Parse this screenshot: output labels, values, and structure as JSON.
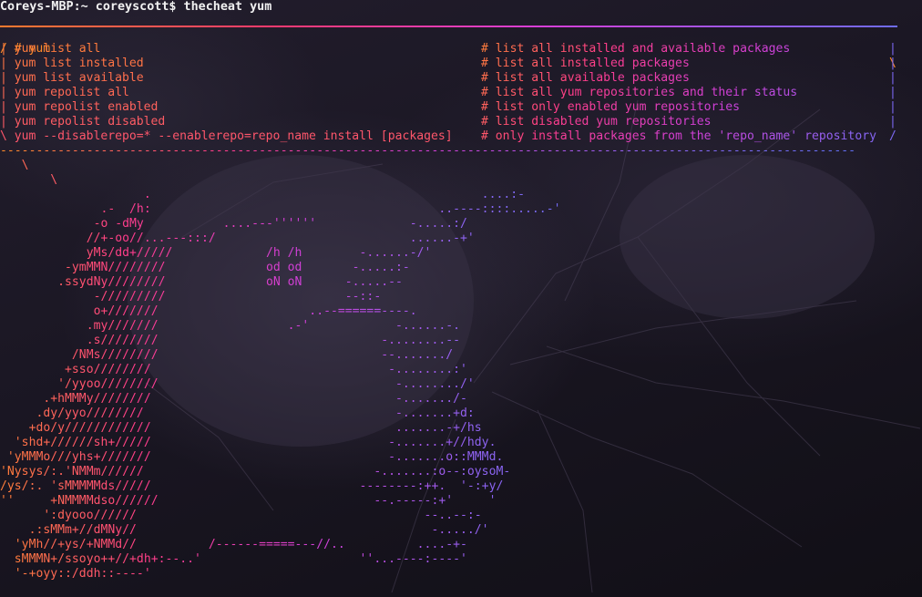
{
  "terminal": {
    "prompt": "Coreys-MBP:~ coreyscott$ thecheat yum",
    "header_left": "/ # yum",
    "header_right": "\\",
    "rows": [
      {
        "cmd": "| yum list all",
        "comment": "# list all installed and available packages",
        "edge": "|"
      },
      {
        "cmd": "| yum list installed",
        "comment": "# list all installed packages",
        "edge": "|"
      },
      {
        "cmd": "| yum list available",
        "comment": "# list all available packages",
        "edge": "|"
      },
      {
        "cmd": "| yum repolist all",
        "comment": "# list all yum repositories and their status",
        "edge": "|"
      },
      {
        "cmd": "| yum repolist enabled",
        "comment": "# list only enabled yum repositories",
        "edge": "|"
      },
      {
        "cmd": "| yum repolist disabled",
        "comment": "# list disabled yum repositories",
        "edge": "|"
      },
      {
        "cmd": "\\ yum --disablerepo=* --enablerepo=repo_name install [packages]",
        "comment": "# only install packages from the 'repo_name' repository",
        "edge": "/"
      }
    ],
    "bottom_rule": "-----------------------------------------------------------------------------------------------------------------------",
    "art": [
      "   \\",
      "       \\",
      "                    .                                              ....:-",
      "              .-  /h:                                        ..----::::.....-'",
      "             -o -dMy           ....---''''''             -.....:/",
      "            //+-oo//...---:::/                           ......-+'",
      "            yMs/dd+/////             /h /h        -......-/'",
      "         -ymMMN////////              od od       -.....:-",
      "        .ssydNy////////              oN oN      -.....--",
      "             -/////////                         --::-",
      "             o+///////                     ..--======----.",
      "            .my///////                  .-'            -......-.",
      "            .s////////                               -........--",
      "          /NMs////////                               --......./",
      "         +sso////////                                 -........:'",
      "        '/yyoo////////                                 -......../'",
      "      .+hMMMy////////                                  -......./-",
      "     .dy/yyo////////                                   -.......+d:",
      "    +do/y////////////                                  .......-+/hs",
      "  'shd+//////sh+/////                                 -.......+//hdy.",
      " 'yMMMo///yhs+///////                                 -.......o::MMMd.",
      "'Nysys/:.'NMMm//////                                -.......:o--:oysoM-",
      "/ys/:. 'sMMMMMds/////                             --------:++.  '-:+y/",
      "''     +NMMMMdso//////                              --.-----:+'     '",
      "      ':dyooo//////                                        --..--:-",
      "    .:sMMm+//dMNy//                                         -...../'",
      "  'yMh//+ys/+NMMd//          /------=====---//..          ....-+-",
      "  sMMMN+/ssoyo++//+dh+:--..'                      ''...----:----'",
      "  '-+oyy::/ddh::----'"
    ]
  },
  "colors": {
    "orange": "#ff8a2a",
    "pink": "#ff3d8a",
    "magenta": "#d13fd6",
    "violet": "#8f63f2",
    "blue": "#5f6ff2",
    "prompt": "#f1f1f1"
  }
}
